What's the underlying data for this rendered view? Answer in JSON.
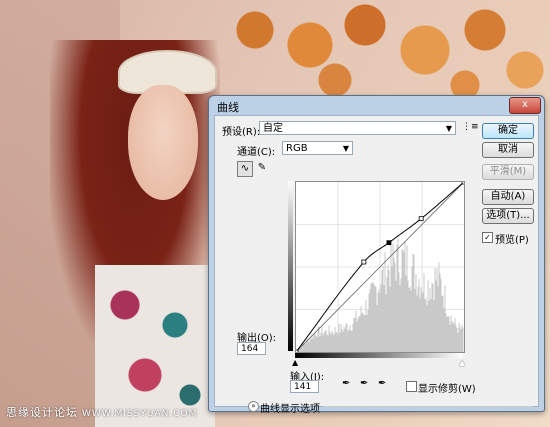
{
  "dialog": {
    "title": "曲线",
    "close_glyph": "x",
    "preset_label": "预设(R):",
    "preset_value": "自定",
    "channel_label": "通道(C):",
    "channel_value": "RGB",
    "output_label": "输出(O):",
    "output_value": "164",
    "input_label": "输入(I):",
    "input_value": "141",
    "show_clipping_label": "显示修剪(W)",
    "display_options_label": "曲线显示选项",
    "buttons": {
      "ok": "确定",
      "cancel": "取消",
      "smooth": "平滑(M)",
      "auto": "自动(A)",
      "options": "选项(T)..."
    },
    "preview_label": "预览(P)",
    "preview_checked": true,
    "show_clipping_checked": false
  },
  "curve": {
    "points_in": [
      0,
      103,
      141,
      190,
      255
    ],
    "points_out": [
      0,
      135,
      164,
      200,
      255
    ]
  },
  "watermark": {
    "text": "思缘设计论坛",
    "site": "WWW.MISSYUAN.COM"
  },
  "icons": {
    "preset_menu": "list-menu-icon",
    "curve_tool": "curve-point-icon",
    "pencil_tool": "pencil-icon",
    "black_eyedropper": "eyedropper-black-icon",
    "gray_eyedropper": "eyedropper-gray-icon",
    "white_eyedropper": "eyedropper-white-icon"
  }
}
